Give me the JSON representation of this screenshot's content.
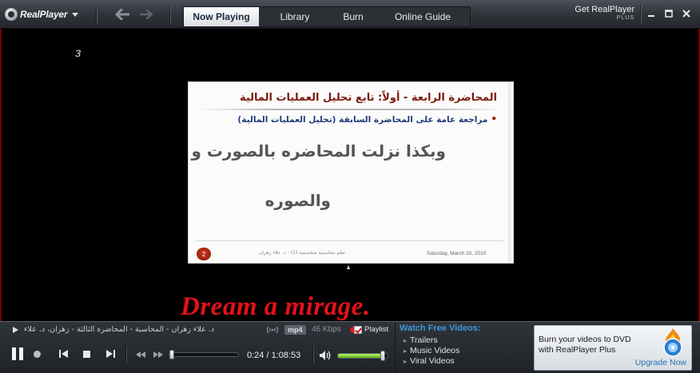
{
  "app": {
    "logo_text": "RealPlayer",
    "get_realplayer_line1": "Get RealPlayer",
    "get_realplayer_line2": "PLUS"
  },
  "tabs": [
    {
      "label": "Now Playing",
      "active": true
    },
    {
      "label": "Library",
      "active": false
    },
    {
      "label": "Burn",
      "active": false
    },
    {
      "label": "Online Guide",
      "active": false
    }
  ],
  "video": {
    "stray_mark": "ɜ",
    "slide": {
      "title": "المحاضرة الرابعة - أولاً: تابع تحليل العمليات المالية",
      "bullet": "مراجعة عامة على المحاضرة السابقة (تحليل العمليات المالية)",
      "big_text_line1": "وبكذا نزلت المحاضره بالصورت و",
      "big_text_line2": "والصوره",
      "slide_number": "2",
      "date": "Saturday, March 20, 2010",
      "footer_text": "نظم محاسبية متخصصة (1) - د. علاء زهران"
    },
    "watermark": "Dream a mirage."
  },
  "controls": {
    "clip_title": "د. علاء زهران - المحاسبة - المحاضرة الثالثة - زهران، د. علاء",
    "format": "mp4",
    "bitrate": "46 Kbps",
    "playlist_label": "Playlist",
    "time_display": "0:24 / 1:08:53",
    "position_fraction": 0.006,
    "volume_fraction": 0.95
  },
  "watch": {
    "title": "Watch Free Videos:",
    "items": [
      "Trailers",
      "Music Videos",
      "Viral Videos"
    ]
  },
  "promo": {
    "line1": "Burn your videos to DVD",
    "line2": "with RealPlayer Plus",
    "cta": "Upgrade Now"
  },
  "colors": {
    "accent_blue": "#3f97d8",
    "watermark_red": "#e3111a",
    "volume_green": "#59b51f"
  }
}
